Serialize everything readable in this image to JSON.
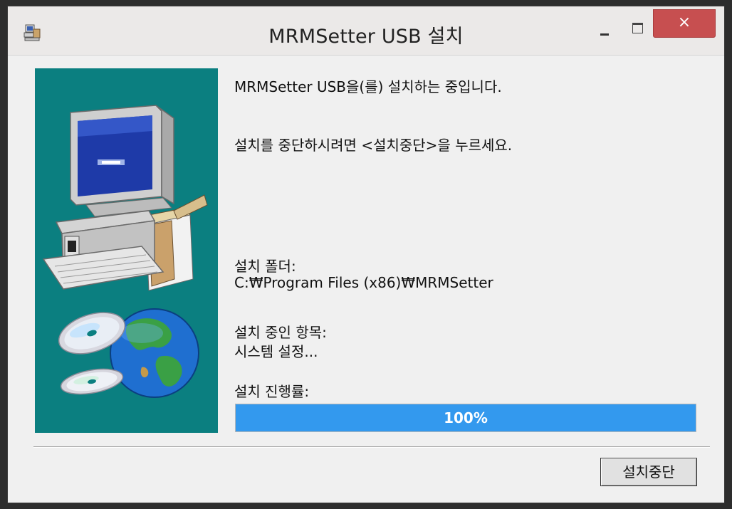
{
  "window": {
    "title": "MRMSetter USB 설치",
    "close_glyph": "×"
  },
  "main": {
    "status_line": "MRMSetter USB을(를) 설치하는 중입니다.",
    "cancel_hint": "설치를 중단하시려면 <설치중단>을 누르세요.",
    "folder_label": "설치 폴더:",
    "folder_path": "C:₩Program Files (x86)₩MRMSetter",
    "item_label": "설치 중인 항목:",
    "item_value": "시스템 설정...",
    "progress_label": "설치 진행률:",
    "progress_text": "100%",
    "progress_fraction": 1.0
  },
  "footer": {
    "cancel_button": "설치중단"
  },
  "colors": {
    "illustration_bg": "#0b7f80",
    "progress_fill": "#3399ee",
    "close_button": "#c74f50"
  },
  "icons": [
    "installer-app-icon",
    "minimize-icon",
    "maximize-icon",
    "close-icon",
    "computer-illustration",
    "globe-cd-illustration"
  ]
}
